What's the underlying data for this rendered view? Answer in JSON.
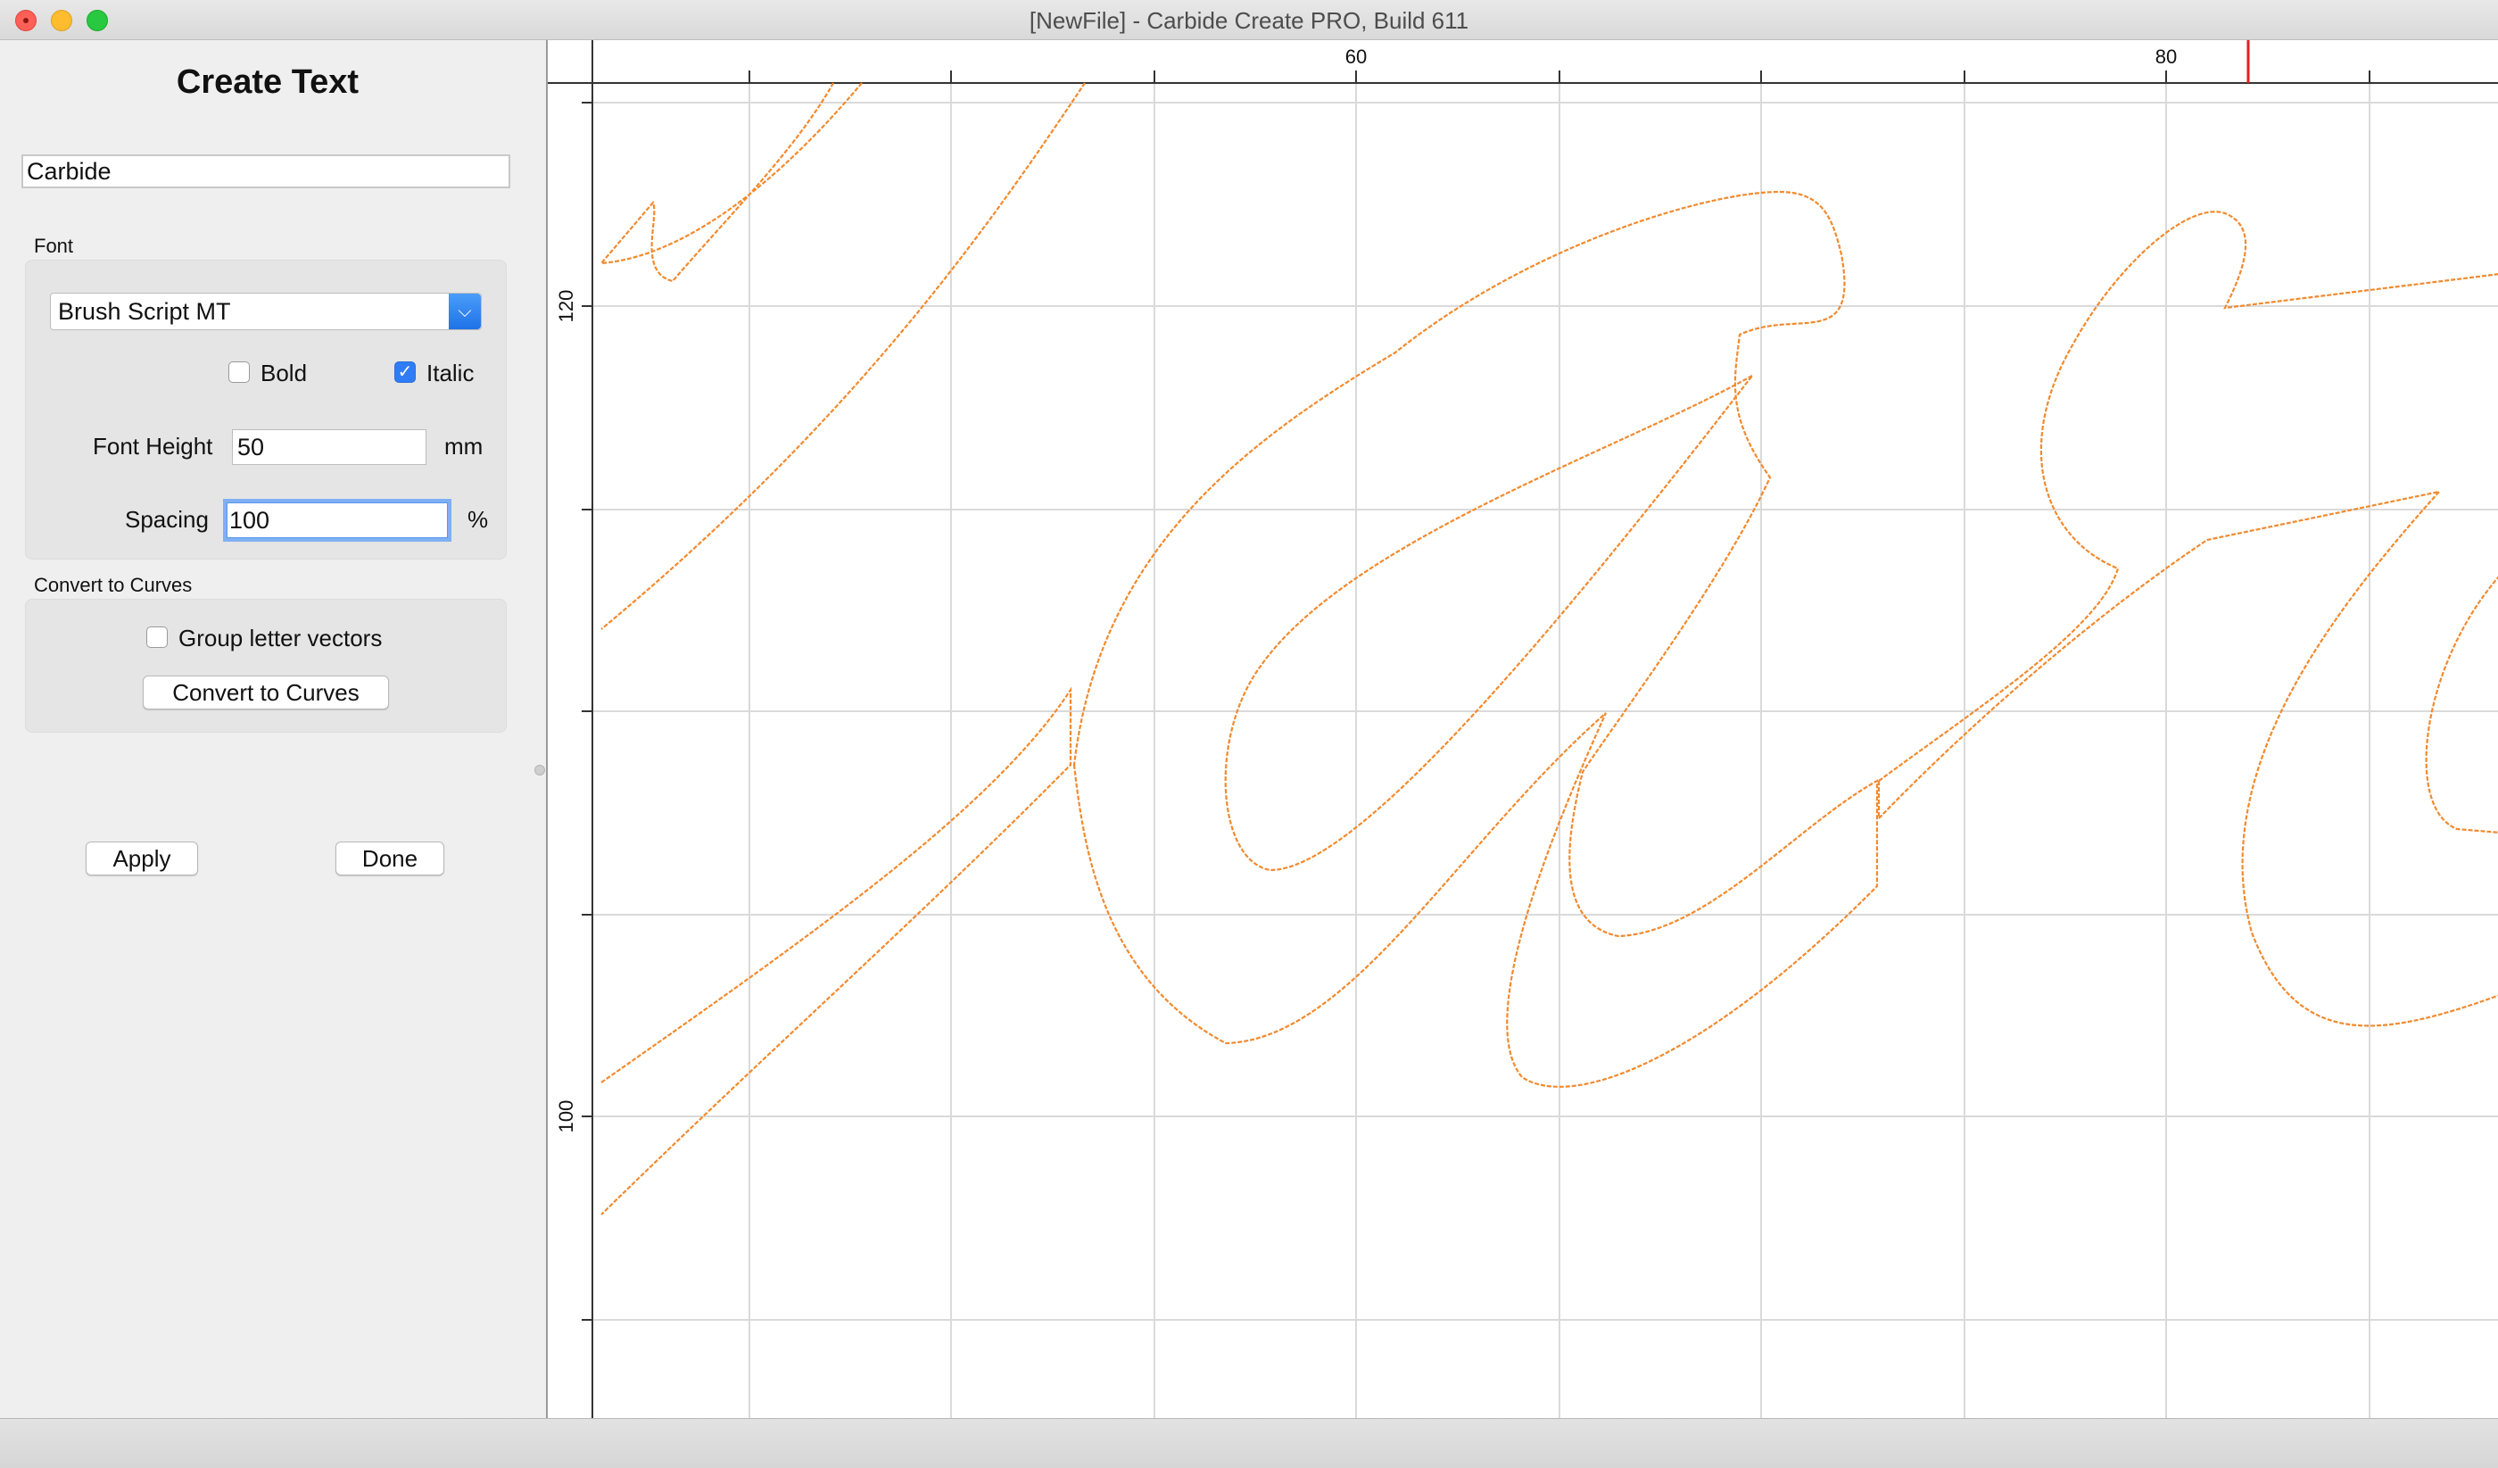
{
  "window": {
    "title": "[NewFile] - Carbide Create PRO, Build 611"
  },
  "panel": {
    "title": "Create Text",
    "text_value": "Carbide",
    "font_section_label": "Font",
    "font_name": "Brush Script MT",
    "bold_label": "Bold",
    "bold_checked": false,
    "italic_label": "Italic",
    "italic_checked": true,
    "font_height_label": "Font Height",
    "font_height_value": "50",
    "font_height_unit": "mm",
    "spacing_label": "Spacing",
    "spacing_value": "100",
    "spacing_unit": "%",
    "curves_section_label": "Convert to Curves",
    "group_label": "Group letter vectors",
    "group_checked": false,
    "convert_button": "Convert to Curves",
    "apply_button": "Apply",
    "done_button": "Done"
  },
  "canvas": {
    "ruler_top_labels": [
      "60",
      "80"
    ],
    "ruler_left_labels": [
      "120",
      "100"
    ],
    "outline_color": "#f28a2e",
    "cursor_marker_color": "#e02020"
  }
}
